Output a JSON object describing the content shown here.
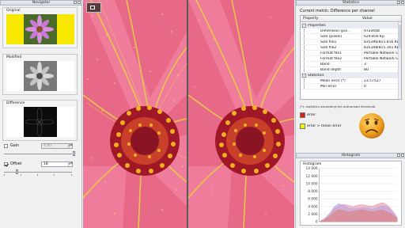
{
  "navigator": {
    "title": "Navigator",
    "original_label": "Original",
    "modified_label": "Modified",
    "difference_label": "Difference",
    "gain_label": "Gain",
    "gain_value": "4,00",
    "gain_enabled": false,
    "offset_label": "Offset",
    "offset_value": "18",
    "offset_enabled": true,
    "spin_arrows": "▲▼"
  },
  "statistics": {
    "title": "Statistics",
    "current_metric": "Current metric: Difference per channel",
    "columns": [
      "Property",
      "Value"
    ],
    "sections": [
      {
        "name": "Properties",
        "expander": "-",
        "rows": [
          {
            "key": "Dimension (pix...",
            "value": "972x648"
          },
          {
            "key": "Size (pixels)",
            "value": "629.856 Kp"
          },
          {
            "key": "Size file1",
            "value": "835396/815.816 KB"
          },
          {
            "key": "Size file2",
            "value": "835348/815.301 KB"
          },
          {
            "key": "Format file1",
            "value": "Portable Network Gra..."
          },
          {
            "key": "Format file2",
            "value": "Portable Network Gra..."
          },
          {
            "key": "Band",
            "value": "3"
          },
          {
            "key": "Band depth",
            "value": "8U"
          }
        ]
      },
      {
        "name": "Statistics",
        "expander": "-",
        "rows": [
          {
            "key": "Mean error (*)",
            "value": "23.57527"
          },
          {
            "key": "Min error",
            "value": "0"
          }
        ]
      }
    ],
    "threshold_note": "(*): statistics exceeding the authorized threshold",
    "legend_error": "error",
    "legend_error_color": "#e0201c",
    "legend_mean": "error > mean error",
    "legend_mean_color": "#f4f400",
    "status_icon": "sad-face-icon",
    "histogram": {
      "title": "Histogram",
      "label": "Histogram"
    }
  },
  "chart_data": {
    "type": "area",
    "title": "Histogram",
    "xlabel": "",
    "ylabel": "",
    "ylim": [
      0,
      14000
    ],
    "yticks": [
      "14 000",
      "12 000",
      "10 000",
      "8 000",
      "6 000",
      "4 000",
      "2 000",
      "0"
    ],
    "grid": true,
    "series": [
      {
        "color": "#e89aae",
        "values": [
          0,
          800,
          2000,
          3400,
          4200,
          4600,
          4300,
          4000,
          4400,
          4500,
          4200,
          4100,
          4700,
          5000,
          4400,
          3000,
          1200
        ]
      },
      {
        "color": "#b8a6de",
        "values": [
          0,
          600,
          1800,
          3900,
          4800,
          4300,
          3600,
          3400,
          3500,
          3700,
          3600,
          3300,
          3800,
          4200,
          3900,
          2700,
          1000
        ]
      },
      {
        "color": "#e08080",
        "values": [
          0,
          500,
          1200,
          2500,
          3200,
          2900,
          2500,
          2800,
          3000,
          3200,
          2800,
          2600,
          2900,
          3100,
          2600,
          1900,
          800
        ]
      }
    ]
  }
}
